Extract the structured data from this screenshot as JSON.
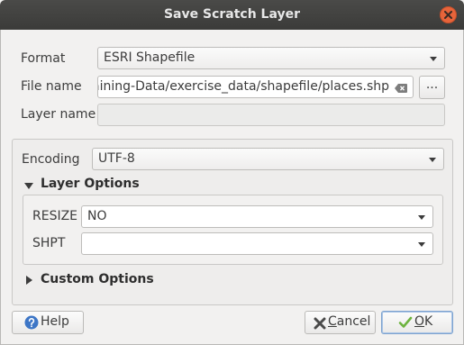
{
  "window": {
    "title": "Save Scratch Layer"
  },
  "form": {
    "format_label": "Format",
    "format_value": "ESRI Shapefile",
    "filename_label": "File name",
    "filename_value": "aining-Data/exercise_data/shapefile/places.shp",
    "browse_label": "...",
    "layername_label": "Layer name",
    "layername_value": ""
  },
  "options": {
    "encoding_label": "Encoding",
    "encoding_value": "UTF-8",
    "layer_options_title": "Layer Options",
    "resize_label": "RESIZE",
    "resize_value": "NO",
    "shpt_label": "SHPT",
    "shpt_value": "",
    "custom_options_title": "Custom Options"
  },
  "buttons": {
    "help_label": "Help",
    "cancel_prefix": "",
    "cancel_mnemonic": "C",
    "cancel_rest": "ancel",
    "ok_mnemonic": "O",
    "ok_rest": "K"
  },
  "icons": {
    "close": "close-icon",
    "clear": "clear-icon",
    "help": "help-icon",
    "cancel": "cancel-icon",
    "ok": "checkmark-icon"
  },
  "colors": {
    "titlebar": "#3b3b39",
    "close_button": "#e7643a",
    "help_icon": "#3d76c6",
    "ok_check": "#6db33f"
  }
}
